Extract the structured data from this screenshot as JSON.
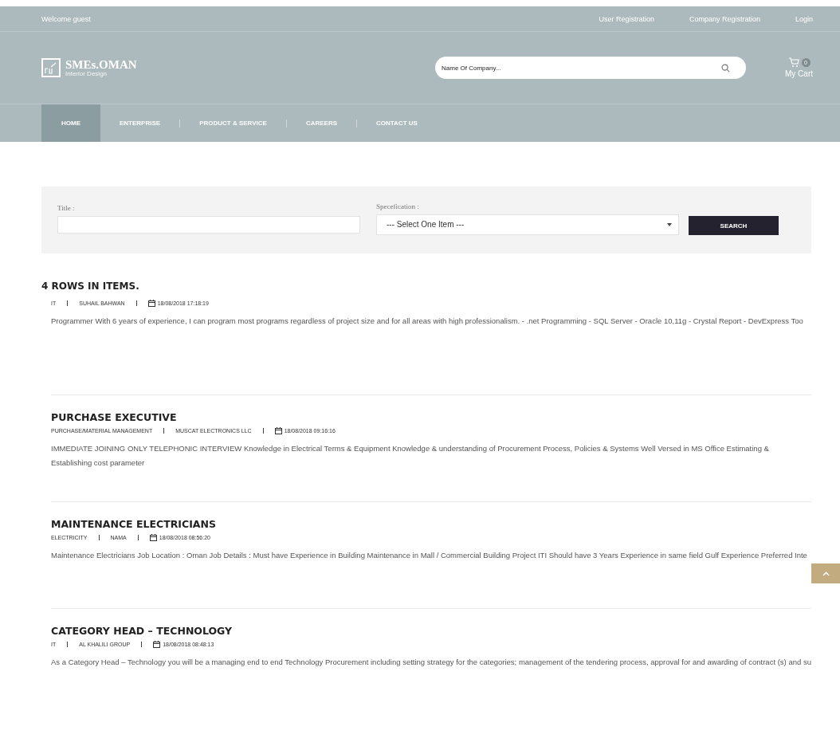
{
  "top_bar": {
    "welcome": "Welcome guest",
    "links": [
      "User Registration",
      "Company Registration",
      "Login"
    ]
  },
  "logo": {
    "name": "SMEs.OMAN",
    "tagline": "Interior Design"
  },
  "company_search": {
    "placeholder": "Name Of Company..."
  },
  "cart": {
    "count": "0",
    "label": "My Cart"
  },
  "nav": [
    {
      "label": "HOME",
      "selected": true
    },
    {
      "label": "ENTERPRISE",
      "selected": false
    },
    {
      "label": "PRODUCT & SERVICE",
      "selected": false
    },
    {
      "label": "CAREERS",
      "selected": false
    },
    {
      "label": "CONTACT US",
      "selected": false
    }
  ],
  "filter": {
    "title_label": "Title :",
    "spec_label": "Specefication :",
    "spec_value": "--- Select One Item ---",
    "button": "SEARCH"
  },
  "results_heading": "4 ROWS IN ITEMS.",
  "jobs": [
    {
      "category": "IT",
      "company": "SUHAIL BAHWAN",
      "date": "18/08/2018 17:18:19",
      "description": "Programmer With 6 years of experience, I can program most programs regardless of project size and for all areas with high professionalism. - .net Programming - SQL Server - Oracle 10,11g - Crystal Report - DevExpress Too"
    },
    {
      "title": "PURCHASE EXECUTIVE",
      "category": "PURCHASE/MATERIAL MANAGEMENT",
      "company": "MUSCAT ELECTRONICS LLC",
      "date": "18/08/2018 09:16:16",
      "description": "IMMEDIATE JOINING ONLY TELEPHONIC INTERVIEW Knowledge in Electrical Terms & Equipment Knowledge & understanding of Procurement Process, Policies & Systems Well Versed in MS Office Estimating & Establishing cost parameter"
    },
    {
      "title": "MAINTENANCE ELECTRICIANS",
      "category": "ELECTRICITY",
      "company": "NAMA",
      "date": "18/08/2018 08:56:20",
      "description": "Maintenance Electricians Job Location : Oman Job Details : Must have Experience in Building Maintenance in Mall / Commercial Building Project ITI Should have 3 Years Experience in same field Gulf Experience Preferred Inte"
    },
    {
      "title": "CATEGORY HEAD – TECHNOLOGY",
      "category": "IT",
      "company": "AL KHALILI GROUP",
      "date": "18/08/2018 08:48:13",
      "description": "As a Category Head – Technology you will be a managing end to end Technology Procurement including setting strategy for the categories; management of the tendering process, approval for and awarding of contract (s) and su"
    }
  ]
}
